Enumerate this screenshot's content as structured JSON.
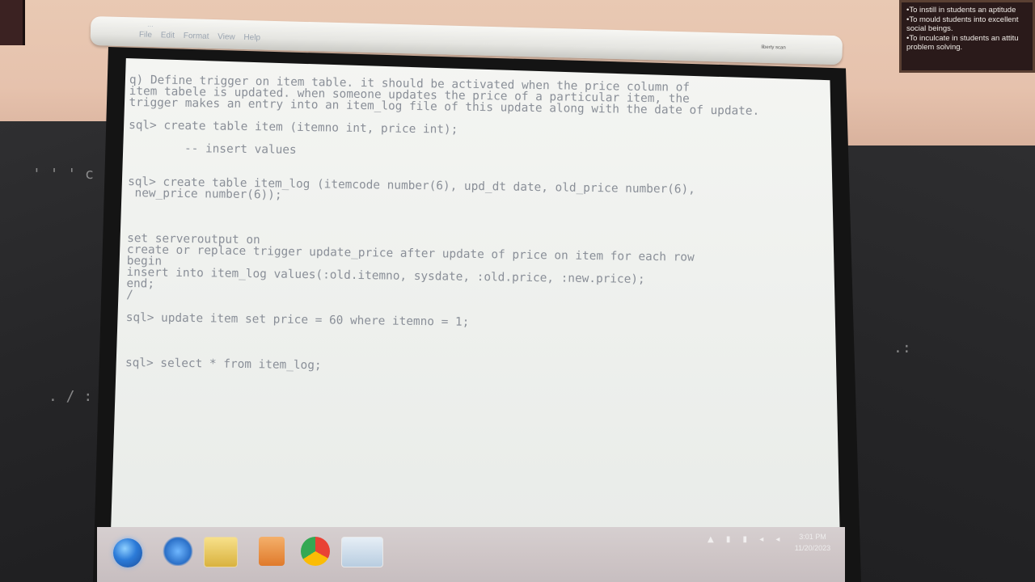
{
  "poster": {
    "lines": [
      "•To instill in students an aptitude",
      "•To mould students into excellent",
      "  social beings.",
      "•To inculcate in students an attitu",
      "  problem solving."
    ]
  },
  "editor": {
    "title": "...",
    "menu": [
      "File",
      "Edit",
      "Format",
      "View",
      "Help"
    ],
    "brand": "liberty scan"
  },
  "code_lines": [
    "q) Define trigger on item table. it should be activated when the price column of",
    "item tabele is updated. when someone updates the price of a particular item, the",
    "trigger makes an entry into an item_log file of this update along with the date of update.",
    "",
    "sql> create table item (itemno int, price int);",
    "",
    "        -- insert values",
    "",
    "",
    "sql> create table item_log (itemcode number(6), upd_dt date, old_price number(6),",
    " new_price number(6));",
    "",
    "",
    "",
    "set serveroutput on",
    "create or replace trigger update_price after update of price on item for each row",
    "begin",
    "insert into item_log values(:old.itemno, sysdate, :old.price, :new.price);",
    "end;",
    "/",
    "",
    "sql> update item set price = 60 where itemno = 1;",
    "",
    "",
    "",
    "sql> select * from item_log;"
  ],
  "taskbar": {
    "items": [
      "start-orb",
      "internet-explorer-icon",
      "file-explorer-icon",
      "media-player-icon",
      "chrome-icon",
      "notepad-icon"
    ],
    "clock_time": "3:01 PM",
    "clock_date": "11/20/2023"
  },
  "colors": {
    "screen_bg": "#eff1ee",
    "code_text": "#8a8f98",
    "taskbar_bg": "#cfc6c7"
  }
}
